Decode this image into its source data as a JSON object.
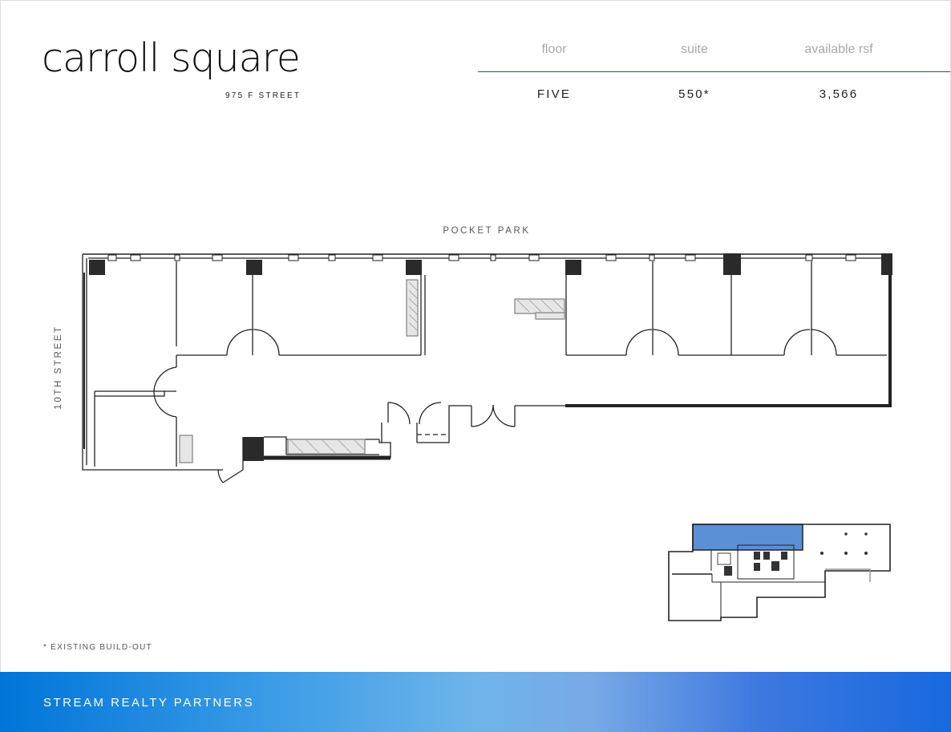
{
  "brand": {
    "name": "carroll square",
    "address": "975 F STREET"
  },
  "summary": {
    "headers": [
      "floor",
      "suite",
      "available rsf"
    ],
    "values": [
      "FIVE",
      "550*",
      "3,566"
    ]
  },
  "plan": {
    "top_street": "POCKET PARK",
    "side_street": "10TH STREET"
  },
  "footnote": "* EXISTING BUILD-OUT",
  "footer": {
    "company": "STREAM REALTY PARTNERS"
  },
  "colors": {
    "highlight": "#5b8fd6",
    "rule": "#2f4f6f",
    "footer_start": "#0075d9",
    "footer_end": "#1769df"
  }
}
